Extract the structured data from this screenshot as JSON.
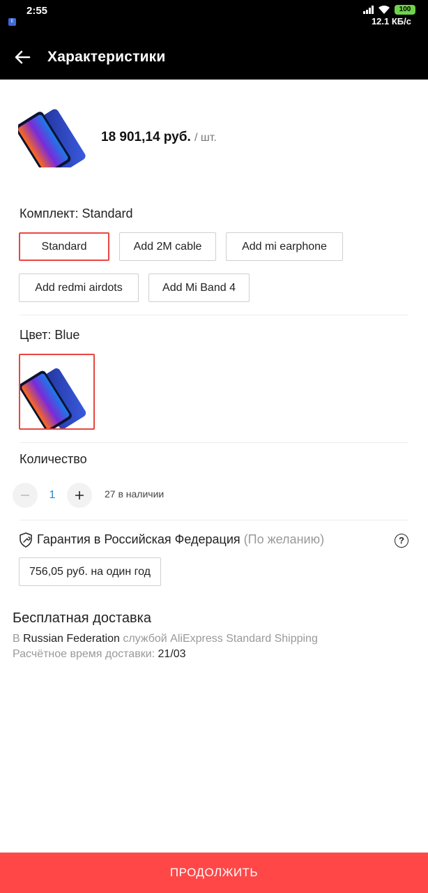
{
  "status_bar": {
    "time": "2:55",
    "battery": "100",
    "speed": "12.1 КБ/с"
  },
  "app_bar": {
    "title": "Характеристики"
  },
  "product": {
    "price": "18 901,14 руб.",
    "unit": "/ шт."
  },
  "kit": {
    "label": "Комплект: Standard",
    "options": [
      "Standard",
      "Add 2M cable",
      "Add mi earphone",
      "Add redmi airdots",
      "Add Mi Band 4"
    ],
    "selected": "Standard"
  },
  "color": {
    "label": "Цвет: Blue"
  },
  "quantity": {
    "label": "Количество",
    "value": "1",
    "stock": "27 в наличии"
  },
  "warranty": {
    "title": "Гарантия в Российская Федерация",
    "optional": "(По желанию)",
    "option": "756,05 руб. на один год"
  },
  "delivery": {
    "title": "Бесплатная доставка",
    "prefix": "В",
    "country": "Russian Federation",
    "service": "службой AliExpress Standard Shipping",
    "eta_label": "Расчётное время доставки:",
    "eta_value": "21/03"
  },
  "footer": {
    "continue_label": "ПРОДОЛЖИТЬ"
  },
  "colors": {
    "accent": "#ff4747",
    "selected_border": "#e9453f",
    "link_blue": "#2a86c8"
  }
}
